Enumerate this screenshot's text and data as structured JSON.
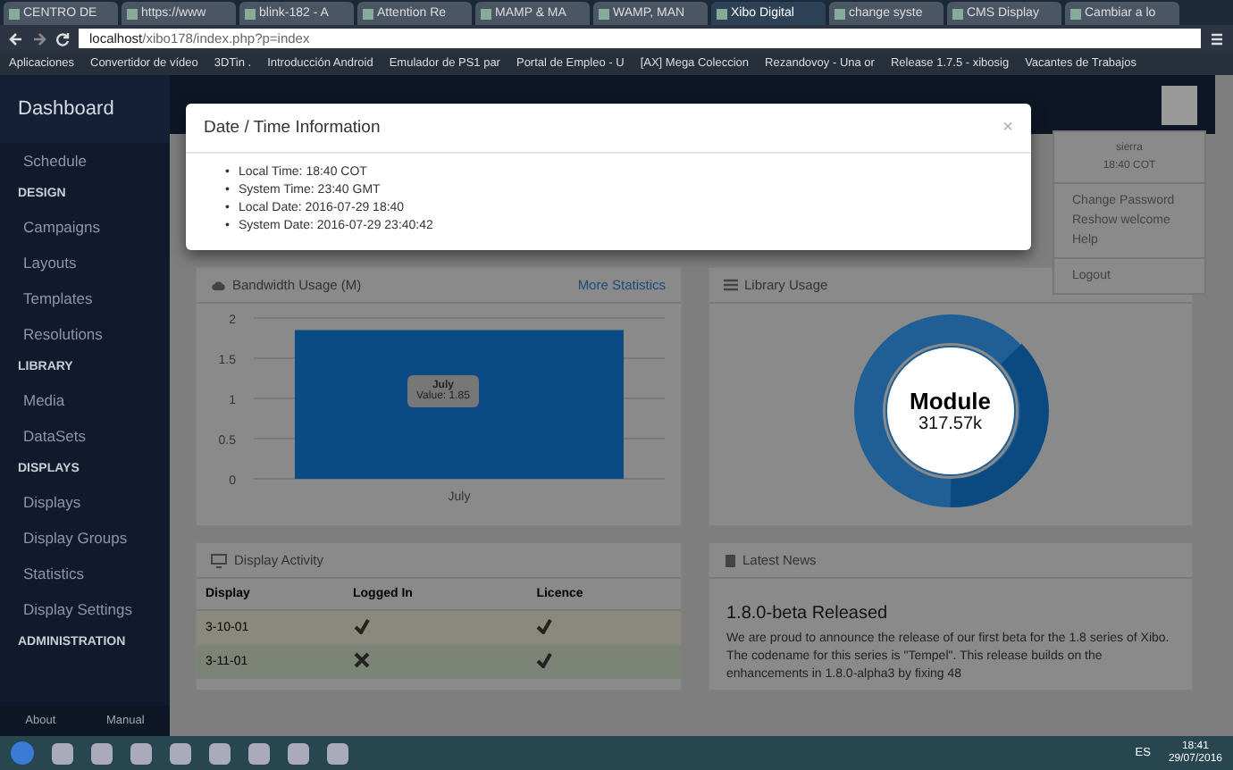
{
  "browser": {
    "tabs": [
      {
        "title": "CENTRO DE",
        "selected": false
      },
      {
        "title": "https://www",
        "selected": false
      },
      {
        "title": "blink-182 - A",
        "selected": false
      },
      {
        "title": "Attention Re",
        "selected": false
      },
      {
        "title": "MAMP & MA",
        "selected": false
      },
      {
        "title": "WAMP, MAN",
        "selected": false
      },
      {
        "title": "Xibo Digital",
        "selected": true
      },
      {
        "title": "change syste",
        "selected": false
      },
      {
        "title": "CMS Display",
        "selected": false
      },
      {
        "title": "Cambiar a lo",
        "selected": false
      }
    ],
    "url_host": "localhost",
    "url_path": "/xibo178/index.php?p=index",
    "bookmarks": [
      "Aplicaciones",
      "Convertidor de vídeo",
      "3DTin .",
      "Introducción Android",
      "Emulador de PS1 par",
      "Portal de Empleo - U",
      "[AX] Mega Coleccion",
      "Rezandovoy - Una or",
      "Release 1.7.5 - xibosig",
      "Vacantes de Trabajos"
    ]
  },
  "sidebar": {
    "title": "Dashboard",
    "items": [
      {
        "kind": "link",
        "label": "Schedule"
      },
      {
        "kind": "header",
        "label": "DESIGN"
      },
      {
        "kind": "link",
        "label": "Campaigns"
      },
      {
        "kind": "link",
        "label": "Layouts"
      },
      {
        "kind": "link",
        "label": "Templates"
      },
      {
        "kind": "link",
        "label": "Resolutions"
      },
      {
        "kind": "header",
        "label": "LIBRARY"
      },
      {
        "kind": "link",
        "label": "Media"
      },
      {
        "kind": "link",
        "label": "DataSets"
      },
      {
        "kind": "header",
        "label": "DISPLAYS"
      },
      {
        "kind": "link",
        "label": "Displays"
      },
      {
        "kind": "link",
        "label": "Display Groups"
      },
      {
        "kind": "link",
        "label": "Statistics"
      },
      {
        "kind": "link",
        "label": "Display Settings"
      },
      {
        "kind": "header",
        "label": "ADMINISTRATION"
      }
    ],
    "footer": [
      "About",
      "Manual"
    ]
  },
  "user_menu": {
    "name": "sierra",
    "time": "18:40 COT",
    "items": [
      "Change Password",
      "Reshow welcome",
      "Help"
    ],
    "logout": "Logout"
  },
  "bandwidth": {
    "title": "Bandwidth Usage (M)",
    "link": "More Statistics",
    "tooltip_title": "July",
    "tooltip_value": "Value: 1.85",
    "chart_data": {
      "type": "bar",
      "categories": [
        "July"
      ],
      "values": [
        1.85
      ],
      "ylim": [
        0,
        2
      ],
      "yticks": [
        0,
        0.5,
        1,
        1.5,
        2
      ],
      "grid": true
    }
  },
  "library": {
    "title": "Library Usage",
    "center_title": "Module",
    "center_value": "317.57k"
  },
  "display_activity": {
    "title": "Display Activity",
    "columns": [
      "Display",
      "Logged In",
      "Licence"
    ],
    "rows": [
      {
        "display": "3-10-01",
        "logged_in": true,
        "licence": true,
        "color": "#8b887d"
      },
      {
        "display": "3-11-01",
        "logged_in": false,
        "licence": true,
        "color": "#7b8477"
      }
    ]
  },
  "news": {
    "title": "Latest News",
    "headline": "1.8.0-beta Released",
    "body": "We are proud to announce the release of our first beta for the 1.8 series of Xibo. The codename for this series is \"Tempel\". This release builds on the enhancements in 1.8.0-alpha3 by fixing 48"
  },
  "modal": {
    "title": "Date / Time Information",
    "close": "×",
    "items": [
      {
        "marker": "•",
        "text": "Local Time: 18:40 COT"
      },
      {
        "marker": "•",
        "text": "System Time: 23:40 GMT"
      },
      {
        "marker": "•",
        "text": "Local Date: 2016-07-29 18:40"
      },
      {
        "marker": "•",
        "text": "System Date: 2016-07-29 23:40:42"
      }
    ]
  },
  "taskbar": {
    "language": "ES",
    "time": "18:41",
    "date": "29/07/2016"
  }
}
